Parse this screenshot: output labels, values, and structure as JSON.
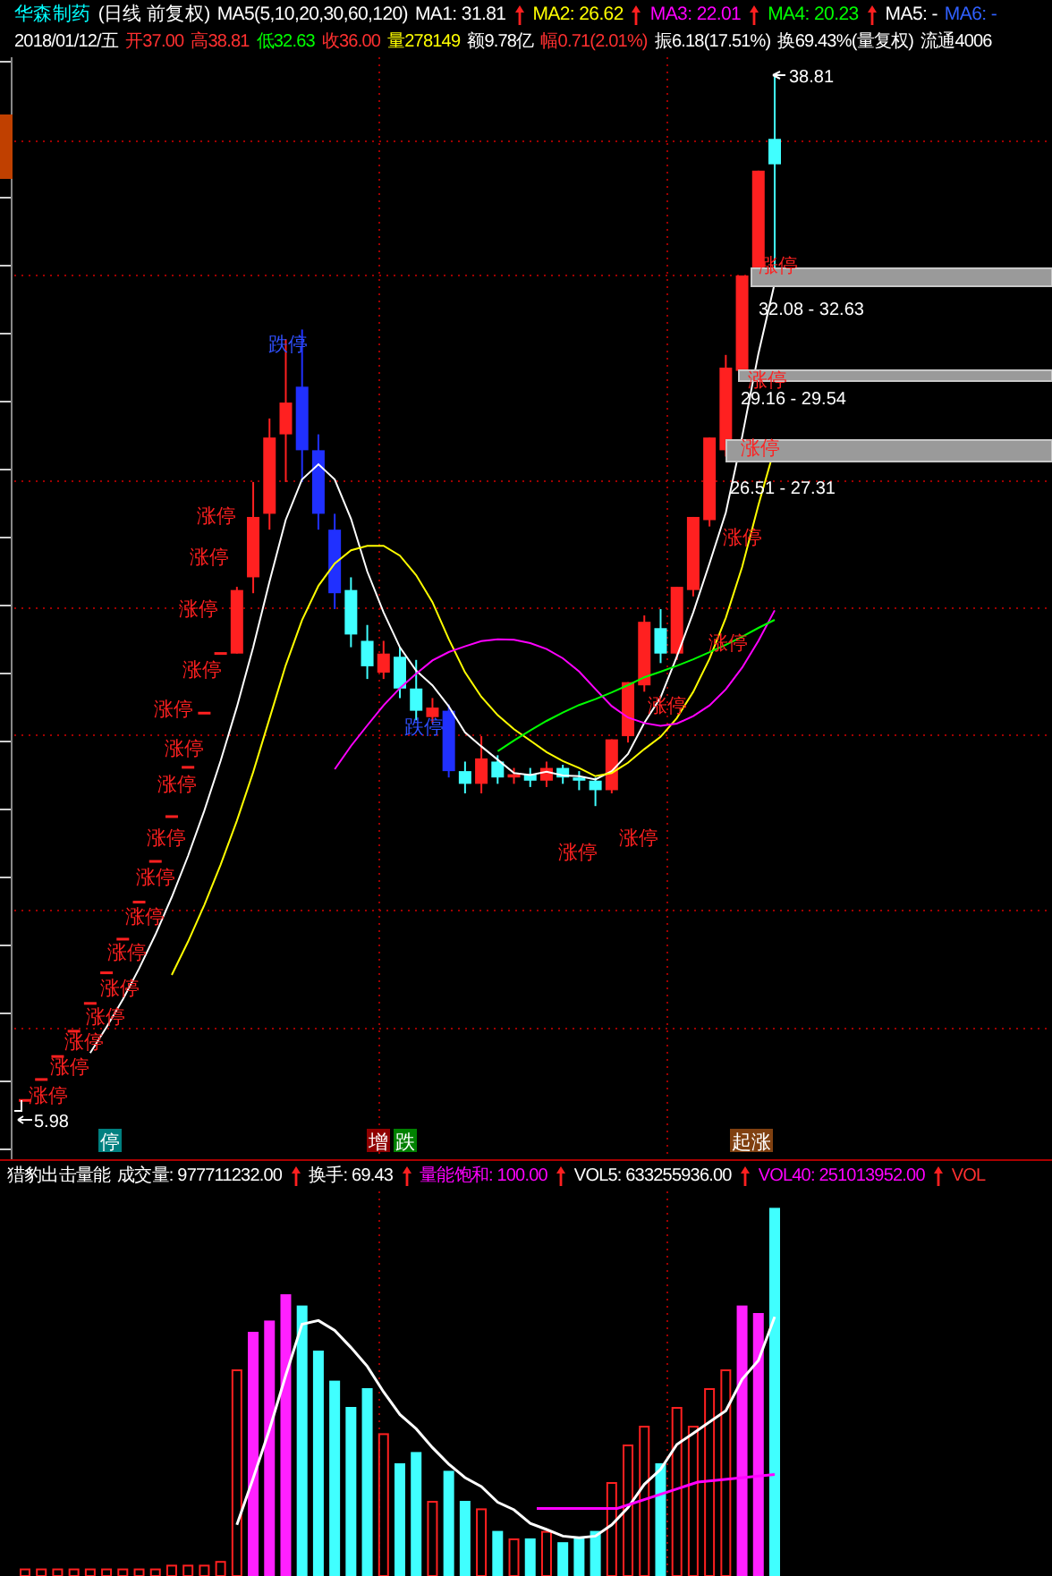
{
  "header": {
    "title": {
      "text": "华森制药",
      "color": "#00ffff"
    },
    "items": [
      {
        "text": "(日线 前复权)",
        "color": "#ffffff"
      },
      {
        "text": "MA5(5,10,20,30,60,120)",
        "color": "#ffffff"
      },
      {
        "text": "MA1: 31.81",
        "color": "#ffffff",
        "up_arrow": true
      },
      {
        "text": "MA2: 26.62",
        "color": "#ffff00",
        "up_arrow": true
      },
      {
        "text": "MA3: 22.01",
        "color": "#ff00ff",
        "up_arrow": true
      },
      {
        "text": "MA4: 20.23",
        "color": "#00ff00",
        "up_arrow": true
      },
      {
        "text": "MA5: -",
        "color": "#ffffff"
      },
      {
        "text": "MA6: -",
        "color": "#3060ff"
      }
    ]
  },
  "quote": [
    {
      "text": "2018/01/12/五",
      "color": "#ffffff"
    },
    {
      "text": "开37.00",
      "color": "#ff3030"
    },
    {
      "text": "高38.81",
      "color": "#ff3030"
    },
    {
      "text": "低32.63",
      "color": "#00ff00"
    },
    {
      "text": "收36.00",
      "color": "#ff3030"
    },
    {
      "text": "量278149",
      "color": "#ffff00"
    },
    {
      "text": "额9.78亿",
      "color": "#ffffff"
    },
    {
      "text": "幅0.71(2.01%)",
      "color": "#ff3030"
    },
    {
      "text": "振6.18(17.51%)",
      "color": "#ffffff"
    },
    {
      "text": "换69.43%(量复权)",
      "color": "#ffffff"
    },
    {
      "text": "流通4006",
      "color": "#ffffff"
    }
  ],
  "main_chart": {
    "high_price": "38.81",
    "low_price": "5.98",
    "limit_tags": [
      {
        "text": "涨停",
        "kind": "up"
      },
      {
        "text": "涨停",
        "kind": "up"
      },
      {
        "text": "涨停",
        "kind": "up"
      },
      {
        "text": "涨停",
        "kind": "up"
      },
      {
        "text": "涨停",
        "kind": "up"
      },
      {
        "text": "涨停",
        "kind": "up"
      },
      {
        "text": "涨停",
        "kind": "up"
      },
      {
        "text": "涨停",
        "kind": "up"
      },
      {
        "text": "涨停",
        "kind": "up"
      },
      {
        "text": "涨停",
        "kind": "up"
      },
      {
        "text": "涨停",
        "kind": "up"
      },
      {
        "text": "涨停",
        "kind": "up"
      },
      {
        "text": "涨停",
        "kind": "up"
      },
      {
        "text": "涨停",
        "kind": "up"
      },
      {
        "text": "涨停",
        "kind": "up"
      },
      {
        "text": "涨停",
        "kind": "up"
      },
      {
        "text": "跌停",
        "kind": "down"
      },
      {
        "text": "跌停",
        "kind": "down"
      },
      {
        "text": "涨停",
        "kind": "up"
      },
      {
        "text": "涨停",
        "kind": "up"
      },
      {
        "text": "涨停",
        "kind": "up"
      },
      {
        "text": "涨停",
        "kind": "up"
      },
      {
        "text": "涨停",
        "kind": "up"
      },
      {
        "text": "涨停",
        "kind": "up"
      },
      {
        "text": "涨停",
        "kind": "up"
      },
      {
        "text": "涨停",
        "kind": "up"
      }
    ],
    "price_bands": [
      "32.08 - 32.63",
      "29.16 - 29.54",
      "26.51 - 27.31"
    ],
    "signals": [
      {
        "text": "停",
        "color": "#008080"
      },
      {
        "text": "增",
        "color": "#900000"
      },
      {
        "text": "跌",
        "color": "#008000"
      },
      {
        "text": "起涨",
        "color": "#804010"
      }
    ]
  },
  "volume_panel": {
    "items": [
      {
        "text": "猎豹出击量能",
        "color": "#ffffff"
      },
      {
        "text": "成交量: 977711232.00",
        "color": "#ffffff",
        "up_arrow": true
      },
      {
        "text": "换手: 69.43",
        "color": "#ffffff",
        "up_arrow": true
      },
      {
        "text": "量能饱和: 100.00",
        "color": "#ff00ff",
        "up_arrow": true
      },
      {
        "text": "VOL5: 633255936.00",
        "color": "#ffffff",
        "up_arrow": true
      },
      {
        "text": "VOL40: 251013952.00",
        "color": "#ff00ff",
        "up_arrow": true
      },
      {
        "text": "VOL",
        "color": "#ff3030"
      }
    ]
  }
}
